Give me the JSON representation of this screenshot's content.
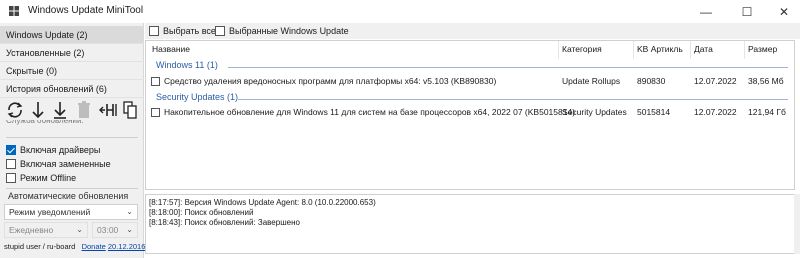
{
  "window": {
    "title": "Windows Update MiniTool",
    "minimize": "—",
    "maximize": "☐",
    "close": "✕"
  },
  "sidebar": {
    "items": [
      {
        "label": "Windows Update (2)"
      },
      {
        "label": "Установленные (2)"
      },
      {
        "label": "Скрытые (0)"
      },
      {
        "label": "История обновлений (6)"
      }
    ],
    "hidden_text": "Служба обновлений:",
    "options": [
      {
        "label": "Включая драйверы",
        "checked": true
      },
      {
        "label": "Включая замененные",
        "checked": false
      },
      {
        "label": "Режим Offline",
        "checked": false
      }
    ],
    "auto_updates_label": "Автоматические обновления",
    "mode_select": "Режим уведомлений",
    "schedule_day": "Ежедневно",
    "schedule_time": "03:00",
    "footer": {
      "user": "stupid user / ru-board",
      "donate": "Donate",
      "date": "20.12.2016"
    }
  },
  "toolbar_icons": [
    "refresh-icon",
    "download-icon",
    "install-icon",
    "delete-icon",
    "hide-icon",
    "copy-icon"
  ],
  "topbar": {
    "select_all": "Выбрать все",
    "selected_updates": "Выбранные Windows Update"
  },
  "table": {
    "columns": [
      "Название",
      "Категория",
      "KB Артикль",
      "Дата",
      "Размер"
    ],
    "groups": [
      {
        "name": "Windows 11 (1)",
        "rows": [
          {
            "name": "Средство удаления вредоносных программ для платформы x64: v5.103 (KB890830)",
            "category": "Update Rollups",
            "kb": "890830",
            "date": "12.07.2022",
            "size": "38,56 Мб"
          }
        ]
      },
      {
        "name": "Security Updates (1)",
        "rows": [
          {
            "name": "Накопительное обновление для Windows 11 для систем на базе процессоров x64, 2022 07 (KB5015814)",
            "category": "Security Updates",
            "kb": "5015814",
            "date": "12.07.2022",
            "size": "121,94 Гб"
          }
        ]
      }
    ]
  },
  "log": [
    "[8:17:57]: Версия Windows Update Agent: 8.0 (10.0.22000.653)",
    "[8:18:00]: Поиск обновлений",
    "[8:18:43]: Поиск обновлений: Завершено"
  ],
  "colors": {
    "accent": "#0067c0",
    "group_header": "#2a5ea8",
    "sidebar_bg": "#f0f0f0"
  }
}
